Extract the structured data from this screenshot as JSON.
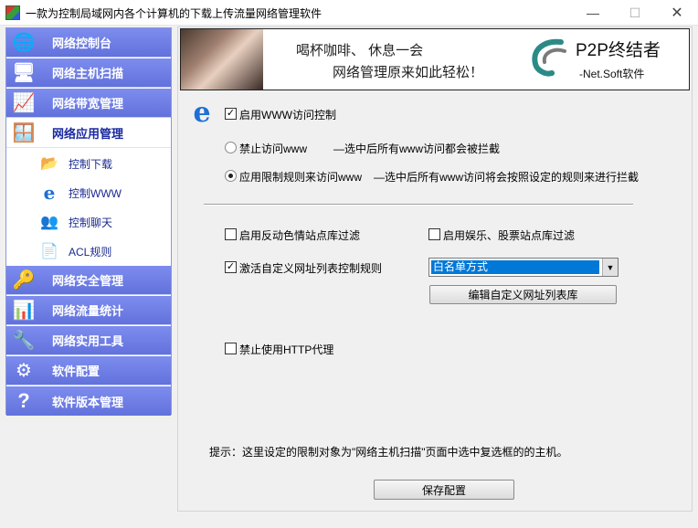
{
  "window": {
    "title": "一款为控制局域网内各个计算机的下载上传流量网络管理软件",
    "controls": {
      "minimize": "—",
      "maximize": "☐",
      "close": "✕"
    }
  },
  "sidebar": {
    "items": [
      {
        "label": "网络控制台",
        "icon": "globe-icon",
        "glyph": "🌐"
      },
      {
        "label": "网络主机扫描",
        "icon": "computer-icon",
        "glyph": "🖥"
      },
      {
        "label": "网络带宽管理",
        "icon": "monitor-graph-icon",
        "glyph": "📈"
      },
      {
        "label": "网络应用管理",
        "icon": "windows-icon",
        "glyph": "🪟"
      }
    ],
    "subitems": [
      {
        "label": "控制下载",
        "icon": "download-folder-icon",
        "glyph": "📂"
      },
      {
        "label": "控制WWW",
        "icon": "internet-explorer-icon",
        "glyph": "e"
      },
      {
        "label": "控制聊天",
        "icon": "chat-users-icon",
        "glyph": "👥"
      },
      {
        "label": "ACL规则",
        "icon": "document-icon",
        "glyph": "📄"
      }
    ],
    "items_after": [
      {
        "label": "网络安全管理",
        "icon": "keys-icon",
        "glyph": "🔑"
      },
      {
        "label": "网络流量统计",
        "icon": "bar-chart-icon",
        "glyph": "📊"
      },
      {
        "label": "网络实用工具",
        "icon": "tools-icon",
        "glyph": "🔧"
      },
      {
        "label": "软件配置",
        "icon": "config-icon",
        "glyph": "⚙"
      },
      {
        "label": "软件版本管理",
        "icon": "help-icon",
        "glyph": "?"
      }
    ]
  },
  "banner": {
    "line1": "喝杯咖啡、 休息一会",
    "line2": "网络管理原来如此轻松！",
    "brand": "P2P终结者",
    "brand_sub": "-Net.Soft软件"
  },
  "www": {
    "enable_label": "启用WWW访问控制",
    "enable_checked": true,
    "ban_label": "禁止访问www",
    "ban_desc": "—选中后所有www访问都会被拦截",
    "rule_label": "应用限制规则来访问www",
    "rule_desc": "—选中后所有www访问将会按照设定的规则来进行拦截",
    "selected_mode": "rule"
  },
  "filters": {
    "reactionary_label": "启用反动色情站点库过滤",
    "reactionary_checked": false,
    "entertainment_label": "启用娱乐、股票站点库过滤",
    "entertainment_checked": false,
    "custom_label": "激活自定义网址列表控制规则",
    "custom_checked": true,
    "list_mode": "白名单方式",
    "edit_button": "编辑自定义网址列表库",
    "http_proxy_label": "禁止使用HTTP代理",
    "http_proxy_checked": false
  },
  "tip": "提示：这里设定的限制对象为\"网络主机扫描\"页面中选中复选框的的主机。",
  "save_button": "保存配置"
}
